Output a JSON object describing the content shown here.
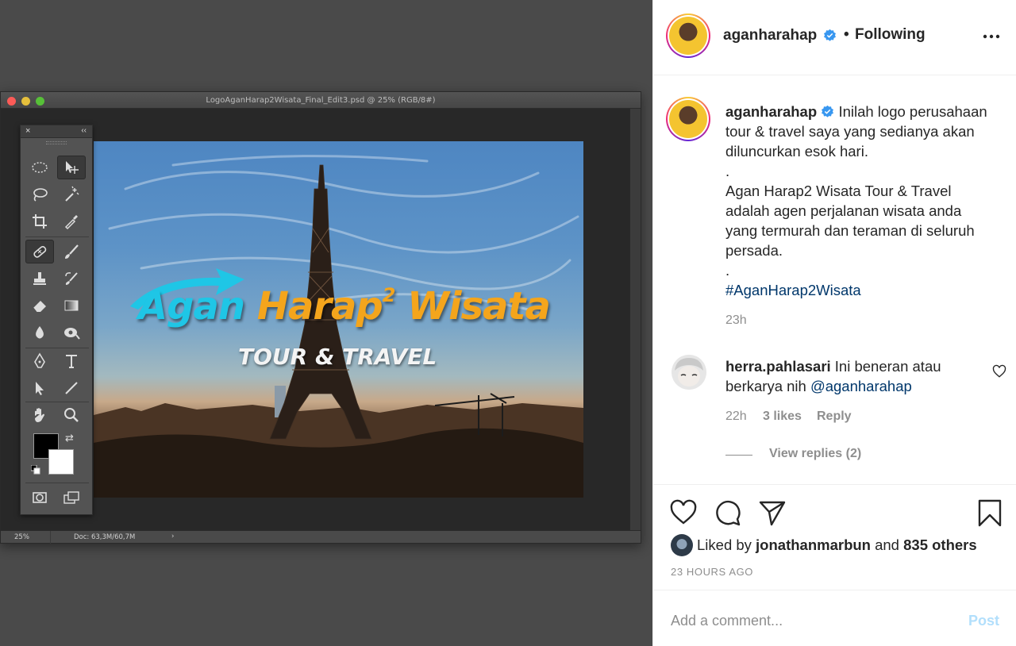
{
  "photoshop": {
    "doc_title": "LogoAganHarap2Wisata_Final_Edit3.psd @ 25% (RGB/8#)",
    "status_zoom": "25%",
    "status_doc": "Doc: 63,3M/60,7M",
    "status_arrow": "›",
    "toolbox_close": "×",
    "toolbox_collapse": "‹‹",
    "swap_glyph": "⇄"
  },
  "artwork": {
    "title_part1": "Agan ",
    "title_part2": "Harap",
    "title_sup": "2",
    "title_part3": " Wisata",
    "subtitle": "TOUR & TRAVEL"
  },
  "post": {
    "username": "aganharahap",
    "dot": "•",
    "follow_label": "Following",
    "caption_lines": [
      "Inilah logo perusahaan",
      "tour & travel saya yang sedianya akan",
      "diluncurkan esok hari.",
      ".",
      "Agan Harap2 Wisata Tour & Travel",
      "adalah agen perjalanan wisata anda",
      "yang termurah dan teraman di seluruh",
      "persada.",
      "."
    ],
    "hashtag": "#AganHarap2Wisata",
    "caption_time": "23h",
    "comment": {
      "username": "herra.pahlasari",
      "text": "Ini beneran atau",
      "text2": "berkarya nih",
      "mention": "@aganharahap",
      "time": "22h",
      "likes": "3 likes",
      "reply": "Reply",
      "view_replies": "View replies (2)"
    },
    "liked_prefix": "Liked by",
    "liked_user": "jonathanmarbun",
    "liked_and": "and",
    "liked_others": "835 others",
    "age": "23 HOURS AGO",
    "comment_placeholder": "Add a comment...",
    "post_label": "Post",
    "colors": {
      "link": "#00376b",
      "muted": "#8e8e8e",
      "post_disabled": "#b2dffc",
      "verified": "#3897f0"
    }
  }
}
